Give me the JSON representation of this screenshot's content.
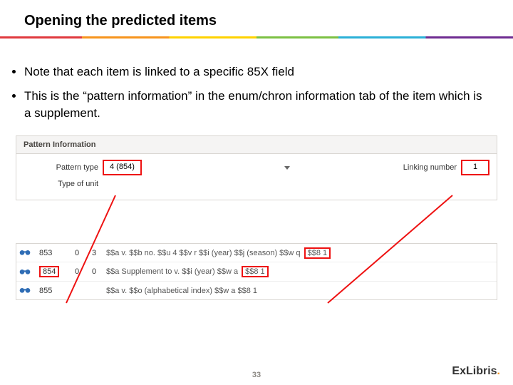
{
  "title": "Opening the predicted items",
  "bullets": {
    "b1": "Note that each item is linked to a specific 85X field",
    "b2": "This is the “pattern information” in the enum/chron information tab of the item which is a supplement."
  },
  "panel": {
    "header": "Pattern Information",
    "pattern_type_label": "Pattern type",
    "pattern_type_value": "4 (854)",
    "linking_label": "Linking number",
    "linking_value": "1",
    "type_unit_label": "Type of unit",
    "type_unit_value": ""
  },
  "marc": {
    "rows": [
      {
        "tag": "853",
        "ind1": "0",
        "ind2": "3",
        "pre": "$$a v. $$b no. $$u 4 $$v r $$i (year) $$j (season) $$w q ",
        "tail": "$$8 1",
        "box_tag": false
      },
      {
        "tag": "854",
        "ind1": "0",
        "ind2": "0",
        "pre": "$$a Supplement to v. $$i (year) $$w a ",
        "tail": "$$8 1",
        "box_tag": true
      },
      {
        "tag": "855",
        "ind1": "",
        "ind2": "",
        "pre": "$$a v. $$o (alphabetical index) $$w a $$8 1",
        "tail": "",
        "box_tag": false
      }
    ]
  },
  "page_number": "33",
  "brand": {
    "name": "ExLibris"
  }
}
